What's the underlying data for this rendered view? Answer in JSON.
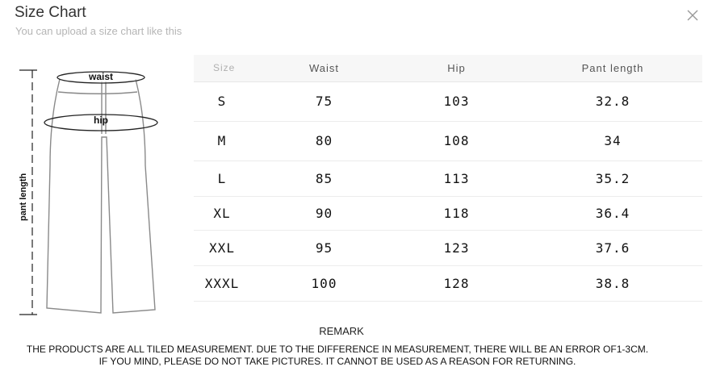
{
  "header": {
    "title": "Size Chart",
    "subtitle": "You can upload a size chart like this",
    "close_icon": "close-icon"
  },
  "diagram": {
    "labels": {
      "waist": "waist",
      "hip": "hip",
      "pant_length": "pant length"
    }
  },
  "table": {
    "headers": [
      "Size",
      "Waist",
      "Hip",
      "Pant length"
    ],
    "rows": [
      [
        "S",
        "75",
        "103",
        "32.8"
      ],
      [
        "M",
        "80",
        "108",
        "34"
      ],
      [
        "L",
        "85",
        "113",
        "35.2"
      ],
      [
        "XL",
        "90",
        "118",
        "36.4"
      ],
      [
        "XXL",
        "95",
        "123",
        "37.6"
      ],
      [
        "XXXL",
        "100",
        "128",
        "38.8"
      ]
    ]
  },
  "remark": {
    "heading": "REMARK",
    "line1": "THE PRODUCTS ARE ALL TILED MEASUREMENT. DUE TO THE DIFFERENCE IN MEASUREMENT, THERE WILL BE AN ERROR OF1-3CM.",
    "line2": "IF YOU MIND, PLEASE DO NOT TAKE PICTURES. IT CANNOT BE USED AS A REASON FOR RETURNING."
  }
}
